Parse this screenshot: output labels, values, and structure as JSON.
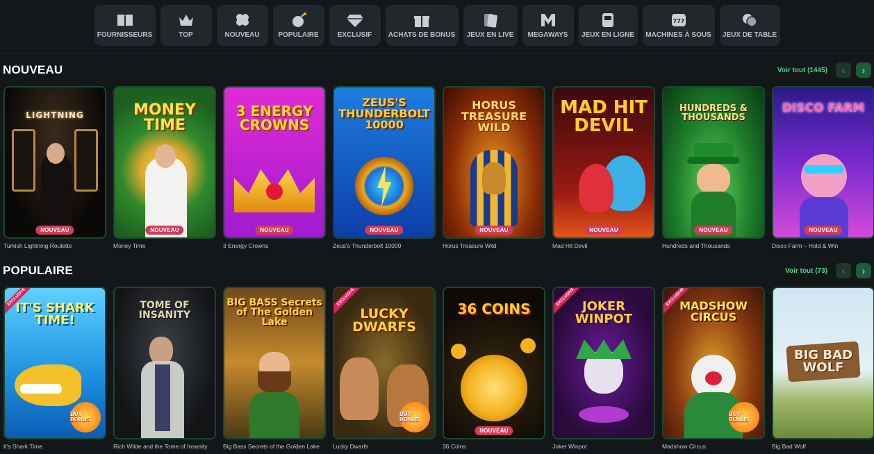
{
  "categories": [
    {
      "label": "FOURNISSEURS",
      "icon": "book-icon"
    },
    {
      "label": "TOP",
      "icon": "crown-icon"
    },
    {
      "label": "NOUVEAU",
      "icon": "clover-icon"
    },
    {
      "label": "POPULAIRE",
      "icon": "bomb-icon"
    },
    {
      "label": "EXCLUSIF",
      "icon": "diamond-icon"
    },
    {
      "label": "ACHATS DE BONUS",
      "icon": "gift-icon"
    },
    {
      "label": "JEUX EN LIVE",
      "icon": "cards-icon"
    },
    {
      "label": "MEGAWAYS",
      "icon": "megaways-icon"
    },
    {
      "label": "JEUX EN LIGNE",
      "icon": "slot-cabinet-icon"
    },
    {
      "label": "MACHINES À SOUS",
      "icon": "slot-777-icon"
    },
    {
      "label": "JEUX DE TABLE",
      "icon": "chips-icon"
    }
  ],
  "nouveau": {
    "title": "NOUVEAU",
    "see_all": "Voir tout (1445)",
    "games": [
      {
        "name": "Turkish Lightning Roulette",
        "badge": "NOUVEAU",
        "art": "LIGHTNING"
      },
      {
        "name": "Money Time",
        "badge": "NOUVEAU",
        "art": "MONEY TIME"
      },
      {
        "name": "3 Energy Crowns",
        "badge": "NOUVEAU",
        "art": "3 ENERGY CROWNS"
      },
      {
        "name": "Zeus's Thunderbolt 10000",
        "badge": "NOUVEAU",
        "art": "ZEUS'S THUNDERBOLT 10000"
      },
      {
        "name": "Horus Treasure Wild",
        "badge": "NOUVEAU",
        "art": "HORUS TREASURE WILD"
      },
      {
        "name": "Mad Hit Devil",
        "badge": "NOUVEAU",
        "art": "MAD HIT DEVIL"
      },
      {
        "name": "Hundreds and Thousands",
        "badge": "NOUVEAU",
        "art": "HUNDREDS & THOUSANDS"
      },
      {
        "name": "Disco Farm – Hold & Win",
        "badge": "NOUVEAU",
        "art": "DISCO FARM"
      }
    ]
  },
  "populaire": {
    "title": "POPULAIRE",
    "see_all": "Voir tout (73)",
    "games": [
      {
        "name": "It's Shark Time",
        "art": "IT'S SHARK TIME!",
        "exclusive": "EXCLUSIVE",
        "bonus": "BUY BONUS"
      },
      {
        "name": "Rich Wilde and the Tome of Insanity",
        "art": "TOME OF INSANITY"
      },
      {
        "name": "Big Bass Secrets of the Golden Lake",
        "art": "BIG BASS Secrets of The Golden Lake"
      },
      {
        "name": "Lucky Dwarfs",
        "art": "LUCKY DWARFS",
        "exclusive": "EXCLUSIVE",
        "bonus": "BUY BONUS"
      },
      {
        "name": "36 Coins",
        "art": "36 COINS",
        "badge": "NOUVEAU"
      },
      {
        "name": "Joker Winpot",
        "art": "JOKER WINPOT",
        "exclusive": "EXCLUSIVE"
      },
      {
        "name": "Madshow Circus",
        "art": "MADSHOW CIRCUS",
        "exclusive": "EXCLUSIVE",
        "bonus": "BUY BONUS"
      },
      {
        "name": "Big Bad Wolf",
        "art": "BIG BAD WOLF"
      }
    ]
  },
  "colors": {
    "accent": "#4ed389",
    "badge": "#d23c57",
    "bg": "#14171a",
    "tile": "#22272c"
  }
}
